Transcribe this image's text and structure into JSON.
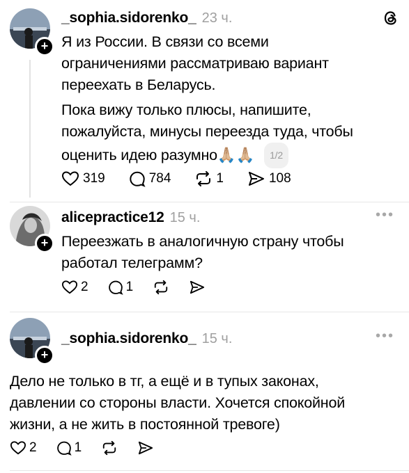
{
  "posts": [
    {
      "username": "_sophia.sidorenko_",
      "time": "23 ч.",
      "lines": [
        "Я из России. В связи со всеми",
        "ограничениями рассматриваю вариант",
        "переехать в Беларусь.",
        "Пока вижу только плюсы, напишите,",
        "пожалуйста, минусы переезда туда, чтобы",
        "оценить идею разумно🙏🏼🙏🏼"
      ],
      "pager": "1/2",
      "likes": "319",
      "comments": "784",
      "reposts": "1",
      "shares": "108"
    },
    {
      "username": "alicepractice12",
      "time": "15 ч.",
      "lines": [
        "Переезжать в аналогичную страну чтобы",
        "работал телеграмм?"
      ],
      "likes": "2",
      "comments": "1"
    },
    {
      "username": "_sophia.sidorenko_",
      "time": "15 ч.",
      "lines": [
        "Дело не только в тг, а ещё и в тупых законах,",
        "давлении со стороны власти. Хочется спокойной",
        "жизни, а не жить в постоянной тревоге)"
      ],
      "likes": "2",
      "comments": "1"
    }
  ],
  "icons": {
    "app_logo": "threads-logo-icon",
    "follow": "plus-icon",
    "like": "heart-icon",
    "comment": "comment-bubble-icon",
    "repost": "repost-icon",
    "share": "share-arrow-icon",
    "more": "more-dots-icon"
  },
  "more_label": "•••",
  "follow_label": "+"
}
